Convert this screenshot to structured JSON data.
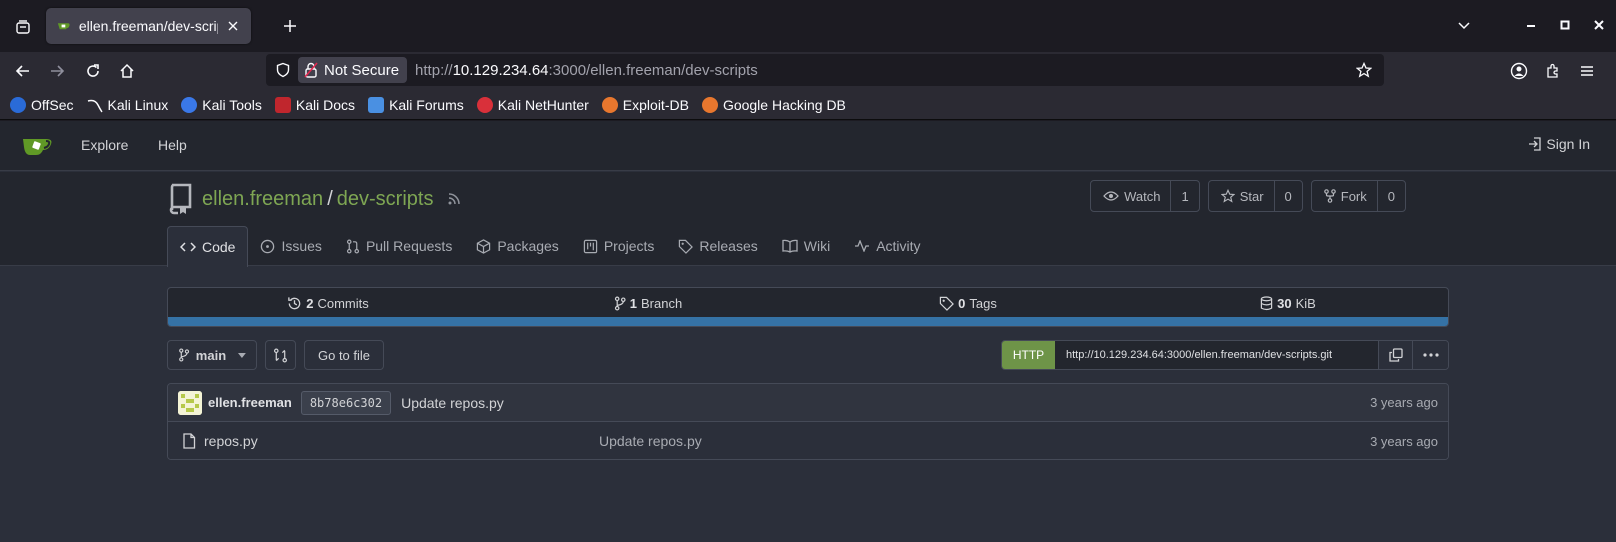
{
  "browser": {
    "tab_title": "ellen.freeman/dev-scripts",
    "url_security": "Not Secure",
    "url_prefix": "http://",
    "url_host": "10.129.234.64",
    "url_rest": ":3000/ellen.freeman/dev-scripts",
    "bookmarks": [
      {
        "label": "OffSec",
        "color": "#2a6bd8"
      },
      {
        "label": "Kali Linux",
        "color": "#1c1b22"
      },
      {
        "label": "Kali Tools",
        "color": "#3a78e8"
      },
      {
        "label": "Kali Docs",
        "color": "#c0262d"
      },
      {
        "label": "Kali Forums",
        "color": "#4a90e2"
      },
      {
        "label": "Kali NetHunter",
        "color": "#d9303a"
      },
      {
        "label": "Exploit-DB",
        "color": "#e8772e"
      },
      {
        "label": "Google Hacking DB",
        "color": "#e8772e"
      }
    ]
  },
  "gitea": {
    "nav": {
      "explore": "Explore",
      "help": "Help",
      "signin": "Sign In"
    },
    "repo": {
      "owner": "ellen.freeman",
      "separator": "/",
      "name": "dev-scripts",
      "watch_label": "Watch",
      "watch_count": "1",
      "star_label": "Star",
      "star_count": "0",
      "fork_label": "Fork",
      "fork_count": "0"
    },
    "tabs": [
      "Code",
      "Issues",
      "Pull Requests",
      "Packages",
      "Projects",
      "Releases",
      "Wiki",
      "Activity"
    ],
    "stats": {
      "commits_num": "2",
      "commits_label": "Commits",
      "branch_num": "1",
      "branch_label": "Branch",
      "tags_num": "0",
      "tags_label": "Tags",
      "size_num": "30",
      "size_label": "KiB"
    },
    "language_color": "#3572a5",
    "toolbar": {
      "branch": "main",
      "go_to_file": "Go to file",
      "clone_protocol": "HTTP",
      "clone_url": "http://10.129.234.64:3000/ellen.freeman/dev-scripts.git"
    },
    "latest_commit": {
      "author": "ellen.freeman",
      "sha": "8b78e6c302",
      "message": "Update repos.py",
      "time": "3 years ago"
    },
    "files": [
      {
        "name": "repos.py",
        "message": "Update repos.py",
        "time": "3 years ago"
      }
    ]
  }
}
